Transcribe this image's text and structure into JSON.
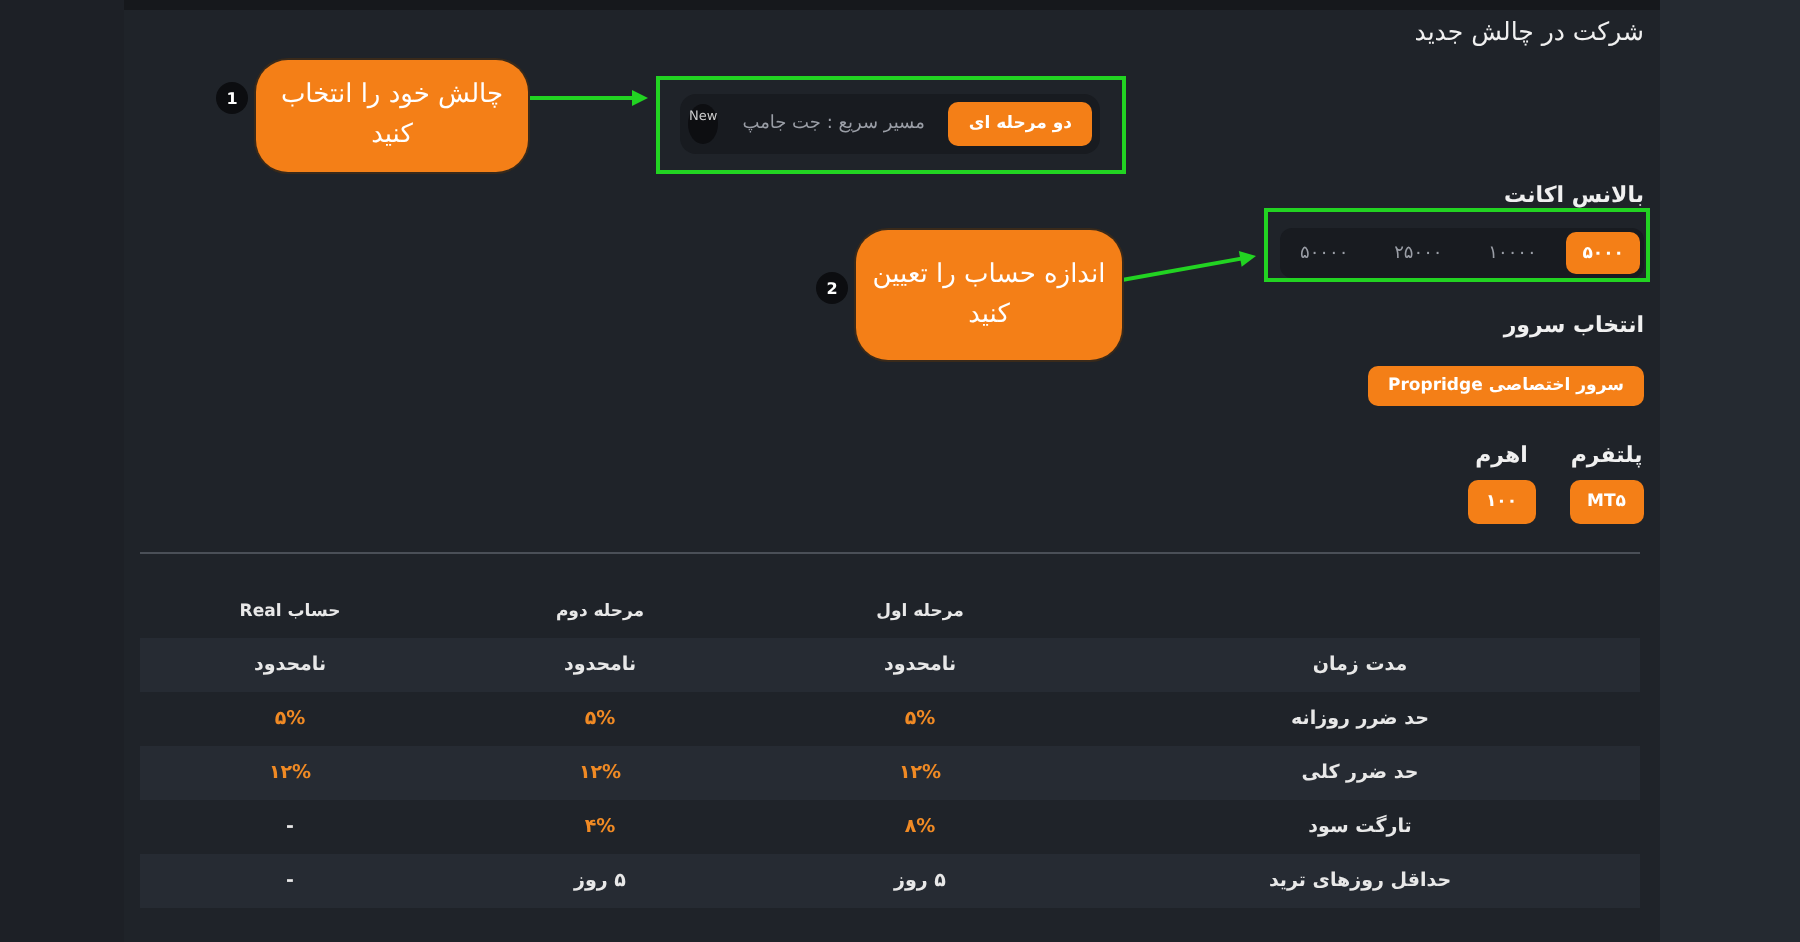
{
  "header": {
    "title": "شرکت در چالش جدید"
  },
  "challenge": {
    "options": [
      {
        "label": "دو مرحله ای",
        "selected": true
      },
      {
        "label": "مسیر سریع : جت جامپ",
        "selected": false,
        "badge": "New"
      }
    ]
  },
  "balance": {
    "label": "بالانس اکانت",
    "options": [
      {
        "label": "۵۰۰۰",
        "selected": true
      },
      {
        "label": "۱۰۰۰۰",
        "selected": false
      },
      {
        "label": "۲۵۰۰۰",
        "selected": false
      },
      {
        "label": "۵۰۰۰۰",
        "selected": false
      }
    ]
  },
  "server": {
    "label": "انتخاب سرور",
    "options": [
      {
        "label": "سرور اختصاصی Propridge",
        "selected": true
      }
    ]
  },
  "platform": {
    "label": "پلتفرم",
    "value": "MT۵"
  },
  "leverage": {
    "label": "اهرم",
    "value": "۱۰۰"
  },
  "annotations": [
    {
      "number": "1",
      "text": "چالش خود را انتخاب کنید"
    },
    {
      "number": "2",
      "text": "اندازه حساب را تعیین کنید"
    }
  ],
  "table": {
    "columns": [
      "مرحله اول",
      "مرحله دوم",
      "حساب Real"
    ],
    "rows": [
      {
        "label": "مدت زمان",
        "cells": [
          {
            "text": "نامحدود",
            "highlight": false
          },
          {
            "text": "نامحدود",
            "highlight": false
          },
          {
            "text": "نامحدود",
            "highlight": false
          }
        ]
      },
      {
        "label": "حد ضرر روزانه",
        "cells": [
          {
            "text": "۵%",
            "highlight": true
          },
          {
            "text": "۵%",
            "highlight": true
          },
          {
            "text": "۵%",
            "highlight": true
          }
        ]
      },
      {
        "label": "حد ضرر کلی",
        "cells": [
          {
            "text": "۱۲%",
            "highlight": true
          },
          {
            "text": "۱۲%",
            "highlight": true
          },
          {
            "text": "۱۲%",
            "highlight": true
          }
        ]
      },
      {
        "label": "تارگت سود",
        "cells": [
          {
            "text": "۸%",
            "highlight": true
          },
          {
            "text": "۴%",
            "highlight": true
          },
          {
            "text": "-",
            "highlight": false
          }
        ]
      },
      {
        "label": "حداقل روزهای ترید",
        "cells": [
          {
            "text": "۵ روز",
            "highlight": false
          },
          {
            "text": "۵ روز",
            "highlight": false
          },
          {
            "text": "-",
            "highlight": false
          }
        ]
      }
    ]
  }
}
